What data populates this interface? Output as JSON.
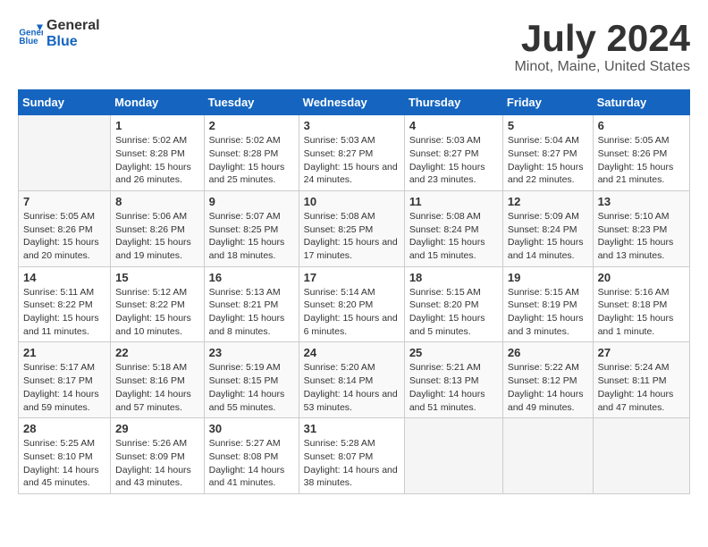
{
  "header": {
    "logo_line1": "General",
    "logo_line2": "Blue",
    "title": "July 2024",
    "subtitle": "Minot, Maine, United States"
  },
  "weekdays": [
    "Sunday",
    "Monday",
    "Tuesday",
    "Wednesday",
    "Thursday",
    "Friday",
    "Saturday"
  ],
  "weeks": [
    [
      {
        "day": "",
        "sunrise": "",
        "sunset": "",
        "daylight": ""
      },
      {
        "day": "1",
        "sunrise": "Sunrise: 5:02 AM",
        "sunset": "Sunset: 8:28 PM",
        "daylight": "Daylight: 15 hours and 26 minutes."
      },
      {
        "day": "2",
        "sunrise": "Sunrise: 5:02 AM",
        "sunset": "Sunset: 8:28 PM",
        "daylight": "Daylight: 15 hours and 25 minutes."
      },
      {
        "day": "3",
        "sunrise": "Sunrise: 5:03 AM",
        "sunset": "Sunset: 8:27 PM",
        "daylight": "Daylight: 15 hours and 24 minutes."
      },
      {
        "day": "4",
        "sunrise": "Sunrise: 5:03 AM",
        "sunset": "Sunset: 8:27 PM",
        "daylight": "Daylight: 15 hours and 23 minutes."
      },
      {
        "day": "5",
        "sunrise": "Sunrise: 5:04 AM",
        "sunset": "Sunset: 8:27 PM",
        "daylight": "Daylight: 15 hours and 22 minutes."
      },
      {
        "day": "6",
        "sunrise": "Sunrise: 5:05 AM",
        "sunset": "Sunset: 8:26 PM",
        "daylight": "Daylight: 15 hours and 21 minutes."
      }
    ],
    [
      {
        "day": "7",
        "sunrise": "Sunrise: 5:05 AM",
        "sunset": "Sunset: 8:26 PM",
        "daylight": "Daylight: 15 hours and 20 minutes."
      },
      {
        "day": "8",
        "sunrise": "Sunrise: 5:06 AM",
        "sunset": "Sunset: 8:26 PM",
        "daylight": "Daylight: 15 hours and 19 minutes."
      },
      {
        "day": "9",
        "sunrise": "Sunrise: 5:07 AM",
        "sunset": "Sunset: 8:25 PM",
        "daylight": "Daylight: 15 hours and 18 minutes."
      },
      {
        "day": "10",
        "sunrise": "Sunrise: 5:08 AM",
        "sunset": "Sunset: 8:25 PM",
        "daylight": "Daylight: 15 hours and 17 minutes."
      },
      {
        "day": "11",
        "sunrise": "Sunrise: 5:08 AM",
        "sunset": "Sunset: 8:24 PM",
        "daylight": "Daylight: 15 hours and 15 minutes."
      },
      {
        "day": "12",
        "sunrise": "Sunrise: 5:09 AM",
        "sunset": "Sunset: 8:24 PM",
        "daylight": "Daylight: 15 hours and 14 minutes."
      },
      {
        "day": "13",
        "sunrise": "Sunrise: 5:10 AM",
        "sunset": "Sunset: 8:23 PM",
        "daylight": "Daylight: 15 hours and 13 minutes."
      }
    ],
    [
      {
        "day": "14",
        "sunrise": "Sunrise: 5:11 AM",
        "sunset": "Sunset: 8:22 PM",
        "daylight": "Daylight: 15 hours and 11 minutes."
      },
      {
        "day": "15",
        "sunrise": "Sunrise: 5:12 AM",
        "sunset": "Sunset: 8:22 PM",
        "daylight": "Daylight: 15 hours and 10 minutes."
      },
      {
        "day": "16",
        "sunrise": "Sunrise: 5:13 AM",
        "sunset": "Sunset: 8:21 PM",
        "daylight": "Daylight: 15 hours and 8 minutes."
      },
      {
        "day": "17",
        "sunrise": "Sunrise: 5:14 AM",
        "sunset": "Sunset: 8:20 PM",
        "daylight": "Daylight: 15 hours and 6 minutes."
      },
      {
        "day": "18",
        "sunrise": "Sunrise: 5:15 AM",
        "sunset": "Sunset: 8:20 PM",
        "daylight": "Daylight: 15 hours and 5 minutes."
      },
      {
        "day": "19",
        "sunrise": "Sunrise: 5:15 AM",
        "sunset": "Sunset: 8:19 PM",
        "daylight": "Daylight: 15 hours and 3 minutes."
      },
      {
        "day": "20",
        "sunrise": "Sunrise: 5:16 AM",
        "sunset": "Sunset: 8:18 PM",
        "daylight": "Daylight: 15 hours and 1 minute."
      }
    ],
    [
      {
        "day": "21",
        "sunrise": "Sunrise: 5:17 AM",
        "sunset": "Sunset: 8:17 PM",
        "daylight": "Daylight: 14 hours and 59 minutes."
      },
      {
        "day": "22",
        "sunrise": "Sunrise: 5:18 AM",
        "sunset": "Sunset: 8:16 PM",
        "daylight": "Daylight: 14 hours and 57 minutes."
      },
      {
        "day": "23",
        "sunrise": "Sunrise: 5:19 AM",
        "sunset": "Sunset: 8:15 PM",
        "daylight": "Daylight: 14 hours and 55 minutes."
      },
      {
        "day": "24",
        "sunrise": "Sunrise: 5:20 AM",
        "sunset": "Sunset: 8:14 PM",
        "daylight": "Daylight: 14 hours and 53 minutes."
      },
      {
        "day": "25",
        "sunrise": "Sunrise: 5:21 AM",
        "sunset": "Sunset: 8:13 PM",
        "daylight": "Daylight: 14 hours and 51 minutes."
      },
      {
        "day": "26",
        "sunrise": "Sunrise: 5:22 AM",
        "sunset": "Sunset: 8:12 PM",
        "daylight": "Daylight: 14 hours and 49 minutes."
      },
      {
        "day": "27",
        "sunrise": "Sunrise: 5:24 AM",
        "sunset": "Sunset: 8:11 PM",
        "daylight": "Daylight: 14 hours and 47 minutes."
      }
    ],
    [
      {
        "day": "28",
        "sunrise": "Sunrise: 5:25 AM",
        "sunset": "Sunset: 8:10 PM",
        "daylight": "Daylight: 14 hours and 45 minutes."
      },
      {
        "day": "29",
        "sunrise": "Sunrise: 5:26 AM",
        "sunset": "Sunset: 8:09 PM",
        "daylight": "Daylight: 14 hours and 43 minutes."
      },
      {
        "day": "30",
        "sunrise": "Sunrise: 5:27 AM",
        "sunset": "Sunset: 8:08 PM",
        "daylight": "Daylight: 14 hours and 41 minutes."
      },
      {
        "day": "31",
        "sunrise": "Sunrise: 5:28 AM",
        "sunset": "Sunset: 8:07 PM",
        "daylight": "Daylight: 14 hours and 38 minutes."
      },
      {
        "day": "",
        "sunrise": "",
        "sunset": "",
        "daylight": ""
      },
      {
        "day": "",
        "sunrise": "",
        "sunset": "",
        "daylight": ""
      },
      {
        "day": "",
        "sunrise": "",
        "sunset": "",
        "daylight": ""
      }
    ]
  ]
}
